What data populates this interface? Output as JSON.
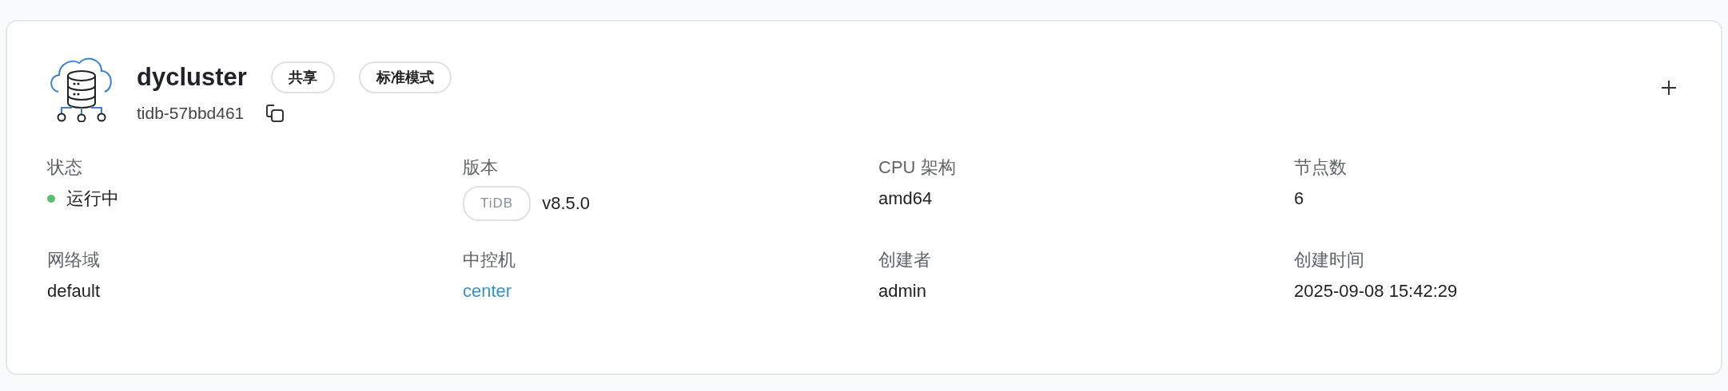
{
  "cluster": {
    "name": "dycluster",
    "id": "tidb-57bbd461",
    "tags": [
      "共享",
      "标准模式"
    ]
  },
  "fields": [
    {
      "label": "状态",
      "kind": "status",
      "value": "运行中",
      "color": "#5cbf6e"
    },
    {
      "label": "版本",
      "kind": "version",
      "badge": "TiDB",
      "value": "v8.5.0"
    },
    {
      "label": "CPU 架构",
      "kind": "text",
      "value": "amd64"
    },
    {
      "label": "节点数",
      "kind": "text",
      "value": "6"
    },
    {
      "label": "网络域",
      "kind": "text",
      "value": "default"
    },
    {
      "label": "中控机",
      "kind": "link",
      "value": "center"
    },
    {
      "label": "创建者",
      "kind": "text",
      "value": "admin"
    },
    {
      "label": "创建时间",
      "kind": "text",
      "value": "2025-09-08 15:42:29"
    }
  ]
}
